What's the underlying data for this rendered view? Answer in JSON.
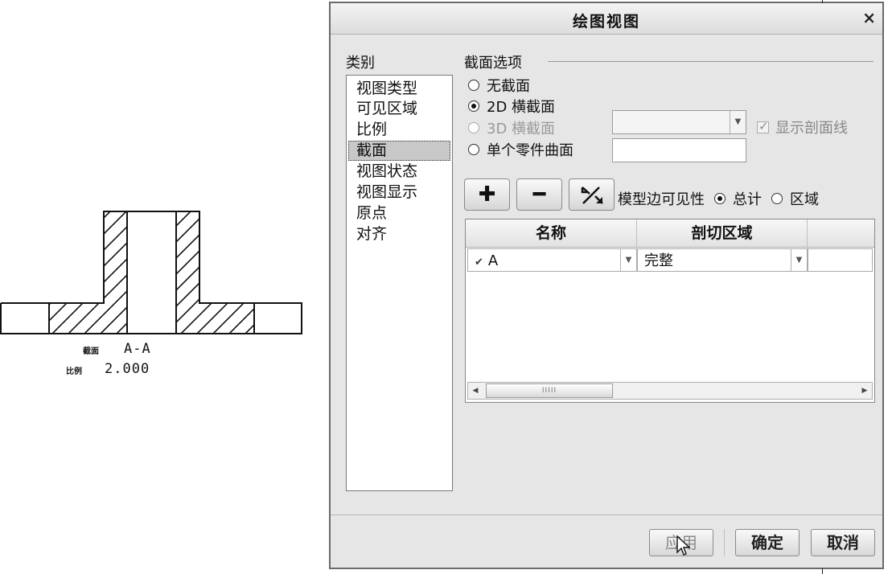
{
  "drawing": {
    "section_label": "截面",
    "section_value": "A-A",
    "scale_label": "比例",
    "scale_value": "2.000"
  },
  "dialog": {
    "title": "绘图视图",
    "category_heading": "类别",
    "categories": [
      "视图类型",
      "可见区域",
      "比例",
      "截面",
      "视图状态",
      "视图显示",
      "原点",
      "对齐"
    ],
    "selected_category": "截面",
    "section_options_heading": "截面选项",
    "options": {
      "no_section": "无截面",
      "section_2d": "2D 横截面",
      "section_3d": "3D 横截面",
      "single_part_surface": "单个零件曲面"
    },
    "selected_option": "2D 横截面",
    "show_hatch_label": "显示剖面线",
    "model_edge_visibility_label": "模型边可见性",
    "visibility_total": "总计",
    "visibility_area": "区域",
    "table": {
      "columns": [
        "名称",
        "剖切区域"
      ],
      "rows": [
        {
          "name": "A",
          "region": "完整"
        }
      ]
    },
    "buttons": {
      "apply": "应用",
      "ok": "确定",
      "cancel": "取消"
    },
    "close_symbol": "×",
    "scroll_thumb_grip": "IIIII"
  },
  "colors": {
    "dialog_bg": "#e6e6e6",
    "selection": "#c8c8c8",
    "disabled_text": "#9a9a9a"
  }
}
